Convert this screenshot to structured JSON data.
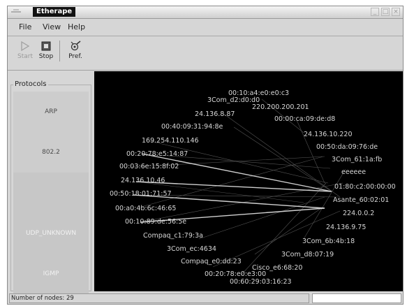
{
  "window": {
    "title": "Etherape"
  },
  "menu": {
    "file": "File",
    "view": "View",
    "help": "Help"
  },
  "toolbar": {
    "start": "Start",
    "stop": "Stop",
    "pref": "Pref."
  },
  "protocols": {
    "label": "Protocols",
    "items": [
      "ARP",
      "802.2",
      "",
      "UDP_UNKNOWN",
      "IGMP"
    ]
  },
  "nodes": [
    "00:10:a4:e0:e0:c3",
    "3Com_d2:d0:d0",
    "220.200.200.201",
    "24.136.8.87",
    "00:00:ca:09:de:d8",
    "00:40:09:31:94:8e",
    "24.136.10.220",
    "169.254.110.146",
    "00:50:da:09:76:de",
    "00:20:78:e5:14:87",
    "3Com_61:1a:fb",
    "00:03:6e:15:8f:02",
    "eeeeee",
    "24.136.10.46",
    "01:80:c2:00:00:00",
    "00:50:18:01:71:57",
    "Asante_60:02:01",
    "00:a0:4b:6c:46:65",
    "224.0.0.2",
    "00:10:89:de:56:5e",
    "24.136.9.75",
    "Compaq_c1:79:3a",
    "3Com_6b:4b:18",
    "3Com_ec:4634",
    "3Com_d8:07:19",
    "Compaq_e0:dd:23",
    "Cisco_e6:68:20",
    "00:20:78:e0:e3:00",
    "00:60:29:03:16:23"
  ],
  "status": {
    "text": "Number of nodes: 29"
  }
}
